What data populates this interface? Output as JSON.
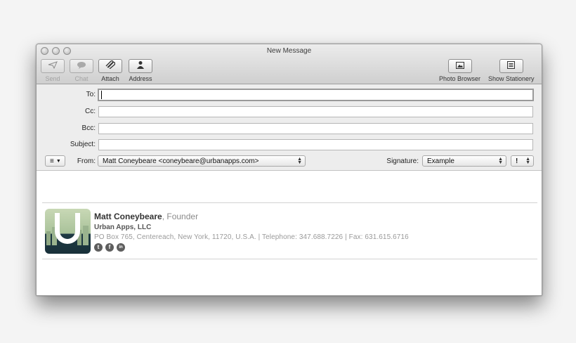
{
  "window": {
    "title": "New Message"
  },
  "toolbar": {
    "send": {
      "label": "Send",
      "icon": "paper-plane-icon",
      "enabled": false
    },
    "chat": {
      "label": "Chat",
      "icon": "speech-bubble-icon",
      "enabled": false
    },
    "attach": {
      "label": "Attach",
      "icon": "paperclip-icon",
      "enabled": true
    },
    "address": {
      "label": "Address",
      "icon": "person-icon",
      "enabled": true
    },
    "photo_browser": {
      "label": "Photo Browser",
      "icon": "photo-icon",
      "enabled": true
    },
    "show_stationery": {
      "label": "Show Stationery",
      "icon": "stationery-icon",
      "enabled": true
    }
  },
  "fields": {
    "to": {
      "label": "To:",
      "value": ""
    },
    "cc": {
      "label": "Cc:",
      "value": ""
    },
    "bcc": {
      "label": "Bcc:",
      "value": ""
    },
    "subject": {
      "label": "Subject:",
      "value": ""
    }
  },
  "from": {
    "label": "From:",
    "value": "Matt Coneybeare <coneybeare@urbanapps.com>"
  },
  "signature": {
    "label": "Signature:",
    "value": "Example"
  },
  "priority": {
    "value": "!"
  },
  "header_menu": {
    "icon": "list-icon"
  },
  "email_signature": {
    "name": "Matt Coneybeare",
    "role": ", Founder",
    "company": "Urban Apps, LLC",
    "address_line": "PO Box 765, Centereach, New York, 11720, U.S.A. | Telephone: 347.688.7226 | Fax: 631.615.6716",
    "social": [
      {
        "glyph": "t",
        "icon": "twitter-icon"
      },
      {
        "glyph": "f",
        "icon": "facebook-icon"
      },
      {
        "glyph": "in",
        "icon": "linkedin-icon"
      }
    ],
    "logo_letter": "U"
  },
  "colors": {
    "logo_dark": "#183039",
    "logo_light": "#c8d8b5",
    "chrome": "#ececec"
  }
}
